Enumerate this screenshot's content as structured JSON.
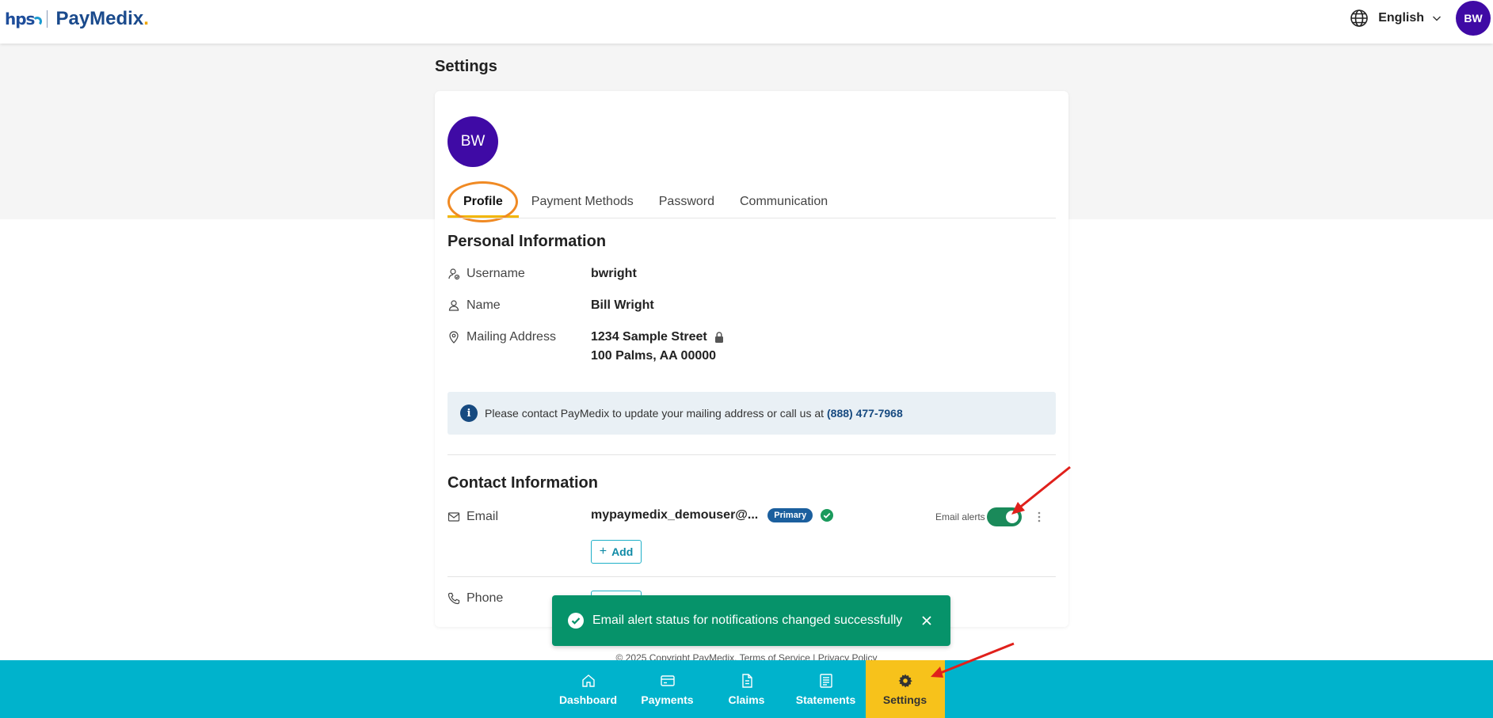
{
  "header": {
    "logo_hps": "hps",
    "logo_name": "PayMedix",
    "logo_dot": ".",
    "language": "English",
    "avatar_initials": "BW"
  },
  "page": {
    "title": "Settings"
  },
  "profile_card": {
    "avatar_initials": "BW",
    "tabs": [
      {
        "label": "Profile",
        "active": true
      },
      {
        "label": "Payment Methods",
        "active": false
      },
      {
        "label": "Password",
        "active": false
      },
      {
        "label": "Communication",
        "active": false
      }
    ]
  },
  "personal_info": {
    "title": "Personal Information",
    "username": {
      "label": "Username",
      "value": "bwright",
      "icon": "user-check-icon"
    },
    "name": {
      "label": "Name",
      "value": "Bill Wright",
      "icon": "user-icon"
    },
    "mailing_address": {
      "label": "Mailing Address",
      "line1": "1234 Sample Street",
      "line2": "100 Palms, AA 00000",
      "icon": "location-pin-icon"
    },
    "notice": {
      "text": "Please contact PayMedix to update your mailing address or call us at",
      "phone": "(888) 477-7968"
    }
  },
  "contact_info": {
    "title": "Contact Information",
    "email": {
      "label": "Email",
      "value": "mypaymedix_demouser@...",
      "badge": "Primary",
      "alerts_label": "Email alerts",
      "alerts_on": true
    },
    "add_label": "Add",
    "phone": {
      "label": "Phone"
    }
  },
  "toast": {
    "message": "Email alert status for notifications changed successfully"
  },
  "footer": {
    "copyright": "© 2025 Copyright PayMedix.",
    "terms": "Terms of Service",
    "separator": "|",
    "privacy": "Privacy Policy"
  },
  "bottom_nav": [
    {
      "label": "Dashboard",
      "icon": "home-icon",
      "active": false
    },
    {
      "label": "Payments",
      "icon": "credit-card-icon",
      "active": false
    },
    {
      "label": "Claims",
      "icon": "document-icon",
      "active": false
    },
    {
      "label": "Statements",
      "icon": "statement-icon",
      "active": false
    },
    {
      "label": "Settings",
      "icon": "gear-icon",
      "active": true
    }
  ],
  "colors": {
    "brand_purple": "#3f0aa5",
    "nav_teal": "#00b3cc",
    "nav_active": "#f7c21b",
    "toast_green": "#06936a",
    "toggle_green": "#1a8a5a",
    "badge_blue": "#1b5f9e",
    "tab_underline": "#f2b600",
    "annotation_red": "#e0201b",
    "annotation_orange": "#f08a24"
  }
}
